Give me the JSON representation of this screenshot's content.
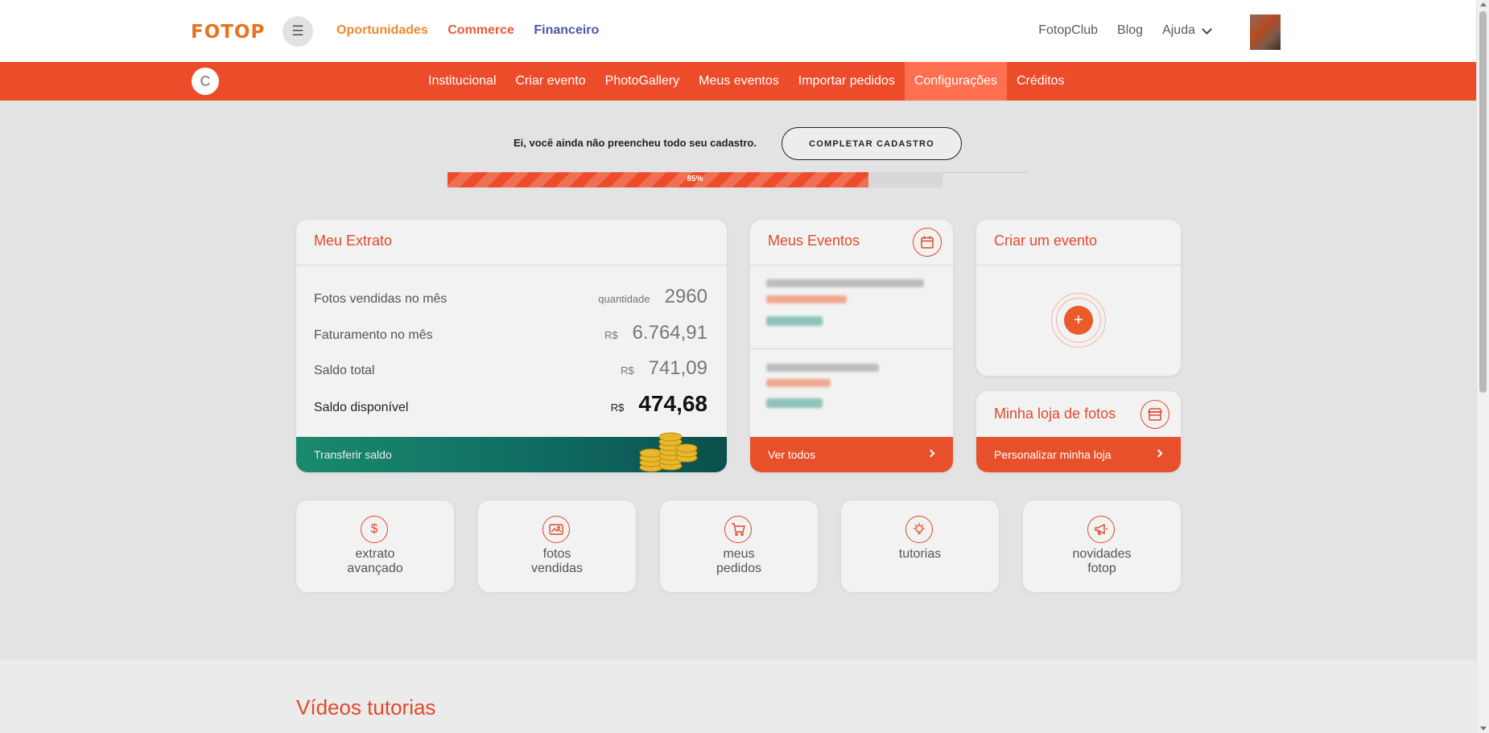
{
  "header": {
    "logo": "FOTOP",
    "menu_icon": "hamburger-icon",
    "nav": [
      "Oportunidades",
      "Commerce",
      "Financeiro"
    ],
    "right_links": [
      "FotopClub",
      "Blog",
      "Ajuda"
    ],
    "brand_color": "#ec4c2a"
  },
  "subnav": {
    "badge": "C",
    "items": [
      "Institucional",
      "Criar evento",
      "PhotoGallery",
      "Meus eventos",
      "Importar pedidos",
      "Configurações",
      "Créditos"
    ],
    "active": "Configurações"
  },
  "profile_completion": {
    "message": "Ei, você ainda não preencheu todo seu cadastro.",
    "button": "COMPLETAR CADASTRO",
    "percent_label": "85%",
    "percent": 85
  },
  "extrato": {
    "title": "Meu Extrato",
    "rows": [
      {
        "label": "Fotos vendidas no mês",
        "unit": "quantidade",
        "value": "2960"
      },
      {
        "label": "Faturamento no mês",
        "unit": "R$",
        "value": "6.764,91"
      },
      {
        "label": "Saldo total",
        "unit": "R$",
        "value": "741,09"
      },
      {
        "label": "Saldo disponível",
        "unit": "R$",
        "value": "474,68"
      }
    ],
    "footer": "Transferir saldo"
  },
  "eventos": {
    "title": "Meus Eventos",
    "icon": "calendar-icon",
    "footer": "Ver todos"
  },
  "criar": {
    "title": "Criar um evento",
    "icon": "plus-icon",
    "plus": "+"
  },
  "loja": {
    "title": "Minha loja de fotos",
    "icon": "store-icon",
    "footer": "Personalizar minha loja"
  },
  "tiles": [
    {
      "label": "extrato\navançado",
      "icon": "dollar-icon"
    },
    {
      "label": "fotos\nvendidas",
      "icon": "photo-icon"
    },
    {
      "label": "meus\npedidos",
      "icon": "cart-icon"
    },
    {
      "label": "tutorias",
      "icon": "lightbulb-icon"
    },
    {
      "label": "novidades\nfotop",
      "icon": "megaphone-icon"
    }
  ],
  "videos": {
    "title": "Vídeos tutorias"
  }
}
